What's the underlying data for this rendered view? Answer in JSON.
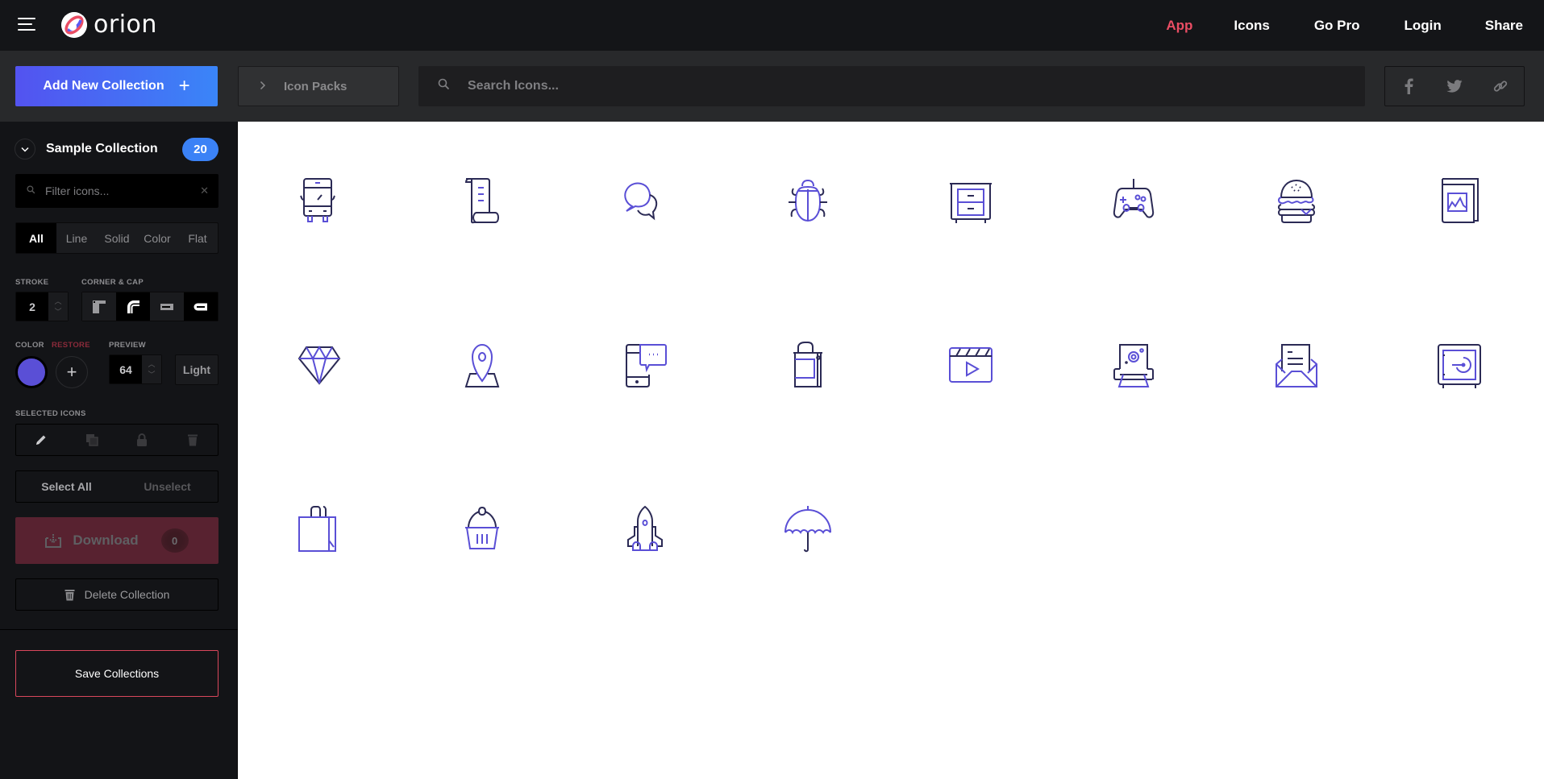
{
  "header": {
    "app_name": "orion",
    "nav": [
      {
        "label": "App",
        "active": true
      },
      {
        "label": "Icons",
        "active": false
      },
      {
        "label": "Go Pro",
        "active": false
      },
      {
        "label": "Login",
        "active": false
      },
      {
        "label": "Share",
        "active": false
      }
    ]
  },
  "toolbar": {
    "add_collection_label": "Add New Collection",
    "icon_packs_label": "Icon Packs",
    "search_placeholder": "Search Icons...",
    "share_icons": [
      "facebook-icon",
      "twitter-icon",
      "link-icon"
    ]
  },
  "sidebar": {
    "collection_name": "Sample Collection",
    "collection_count": "20",
    "filter_placeholder": "Filter icons...",
    "style_tabs": [
      {
        "label": "All",
        "active": true
      },
      {
        "label": "Line",
        "active": false
      },
      {
        "label": "Solid",
        "active": false
      },
      {
        "label": "Color",
        "active": false
      },
      {
        "label": "Flat",
        "active": false
      }
    ],
    "stroke_label": "STROKE",
    "stroke_value": "2",
    "corner_cap_label": "CORNER & CAP",
    "corner_cap_options": [
      "square-corner",
      "round-corner",
      "butt-cap",
      "round-cap"
    ],
    "color_label": "COLOR",
    "restore_label": "RESTORE",
    "preview_label": "PREVIEW",
    "preview_value": "64",
    "light_label": "Light",
    "current_color": "#5a4fd6",
    "selected_icons_label": "SELECTED ICONS",
    "selected_tools": [
      "pencil-icon",
      "duplicate-icon",
      "lock-icon",
      "trash-icon"
    ],
    "select_all_label": "Select All",
    "unselect_label": "Unselect",
    "download_label": "Download",
    "download_count": "0",
    "delete_label": "Delete Collection",
    "save_label": "Save Collections"
  },
  "colors": {
    "accent": "#ea4d64",
    "primary_icon": "#5a4fd6",
    "secondary_icon": "#2b2a55",
    "badge": "#3b82f6"
  },
  "icons": [
    {
      "name": "bus-icon"
    },
    {
      "name": "scroll-icon"
    },
    {
      "name": "chat-bubbles-icon"
    },
    {
      "name": "bug-icon"
    },
    {
      "name": "cabinet-icon"
    },
    {
      "name": "gamepad-icon"
    },
    {
      "name": "burger-icon"
    },
    {
      "name": "photo-book-icon"
    },
    {
      "name": "diamond-icon"
    },
    {
      "name": "map-pin-icon"
    },
    {
      "name": "phone-chat-icon"
    },
    {
      "name": "shopping-bag-icon"
    },
    {
      "name": "video-clapper-icon"
    },
    {
      "name": "printer-icon"
    },
    {
      "name": "open-mail-icon"
    },
    {
      "name": "safe-icon"
    },
    {
      "name": "paper-bag-icon"
    },
    {
      "name": "cupcake-icon"
    },
    {
      "name": "rocket-icon"
    },
    {
      "name": "umbrella-icon"
    }
  ]
}
